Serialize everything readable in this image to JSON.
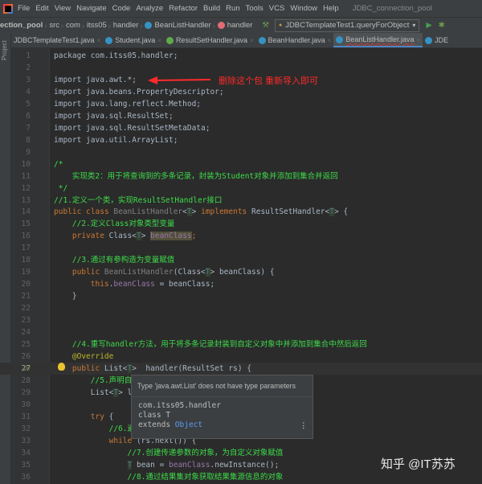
{
  "menubar": {
    "items": [
      "File",
      "Edit",
      "View",
      "Navigate",
      "Code",
      "Analyze",
      "Refactor",
      "Build",
      "Run",
      "Tools",
      "VCS",
      "Window",
      "Help"
    ],
    "window_title": "JDBC_connection_pool"
  },
  "navbar": {
    "project": "ection_pool",
    "crumbs": [
      "src",
      "com",
      "itss05",
      "handler"
    ],
    "class_crumb": "BeanListHandler",
    "method_crumb": "handler",
    "run_config": "JDBCTemplateTest1.queryForObject"
  },
  "side_label": "Project",
  "tabs": [
    {
      "label": "JDBCTemplateTest1.java",
      "icon": "class"
    },
    {
      "label": "Student.java",
      "icon": "class"
    },
    {
      "label": "ResultSetHandler.java",
      "icon": "interface"
    },
    {
      "label": "BeanHandler.java",
      "icon": "class"
    },
    {
      "label": "BeanListHandler.java",
      "icon": "class",
      "active": true
    },
    {
      "label": "JDE",
      "icon": "class"
    }
  ],
  "code_lines": [
    [
      [
        "package com.itss05.handler;",
        "pl"
      ]
    ],
    [],
    [
      [
        "import java.awt.*;",
        "pl"
      ]
    ],
    [
      [
        "import java.beans.PropertyDescriptor;",
        "pl"
      ]
    ],
    [
      [
        "import java.lang.reflect.Method;",
        "pl"
      ]
    ],
    [
      [
        "import java.sql.ResultSet;",
        "pl"
      ]
    ],
    [
      [
        "import java.sql.ResultSetMetaData;",
        "pl"
      ]
    ],
    [
      [
        "import java.util.ArrayList;",
        "pl"
      ]
    ],
    [],
    [
      [
        "/*",
        "gc"
      ]
    ],
    [
      [
        "    实现类2：用于将查询到的多条记录，封装为Student对象并添加到集合并返回",
        "gc"
      ]
    ],
    [
      [
        " */",
        "gc"
      ]
    ],
    [
      [
        "//1.定义一个类，实现ResultSetHandler接口",
        "gc"
      ]
    ],
    [
      [
        "public class ",
        "kw"
      ],
      [
        "BeanListHandler",
        "gr"
      ],
      [
        "<",
        "pl"
      ],
      [
        "T",
        "tp"
      ],
      [
        "> ",
        "pl"
      ],
      [
        "implements ",
        "kw"
      ],
      [
        "ResultSetHandler<",
        "pl"
      ],
      [
        "T",
        "tp"
      ],
      [
        "> {",
        "pl"
      ]
    ],
    [
      [
        "    //2.定义Class对象类型变量",
        "gc"
      ]
    ],
    [
      [
        "    private ",
        "kw"
      ],
      [
        "Class<",
        "pl"
      ],
      [
        "T",
        "tp"
      ],
      [
        "> ",
        "pl"
      ],
      [
        "beanClass",
        "hl"
      ],
      [
        ";",
        "kw"
      ]
    ],
    [],
    [
      [
        "    //3.通过有参构造为变量赋值",
        "gc"
      ]
    ],
    [
      [
        "    public ",
        "kw"
      ],
      [
        "BeanListHandler",
        "gr"
      ],
      [
        "(Class<",
        "pl"
      ],
      [
        "T",
        "tp"
      ],
      [
        "> beanClass) {",
        "pl"
      ]
    ],
    [
      [
        "        this",
        "kw"
      ],
      [
        ".",
        "pl"
      ],
      [
        "beanClass",
        "fd"
      ],
      [
        " = beanClass;",
        "pl"
      ]
    ],
    [
      [
        "    }",
        "pl"
      ]
    ],
    [],
    [],
    [],
    [
      [
        "    //4.重写handler方法，用于将多条记录封装到自定义对象中并添加到集合中然后返回",
        "gc"
      ]
    ],
    [
      [
        "    @Override",
        "an"
      ]
    ],
    [
      [
        "    public ",
        "kw"
      ],
      [
        "List<",
        "pl"
      ],
      [
        "T",
        "tp"
      ],
      [
        ">  handler(ResultSet rs) {",
        "pl"
      ]
    ],
    [
      [
        "        //5.声明自",
        "gc"
      ]
    ],
    [
      [
        "        List<",
        "pl"
      ],
      [
        "T",
        "tp"
      ],
      [
        "> l",
        "pl"
      ]
    ],
    [],
    [
      [
        "        try ",
        "kw"
      ],
      [
        "{",
        "pl"
      ]
    ],
    [
      [
        "            //6.遍",
        "gc"
      ]
    ],
    [
      [
        "            while ",
        "kw"
      ],
      [
        "(rs.next()) {",
        "pl"
      ]
    ],
    [
      [
        "                //7.创建传递参数的对象，为自定义对象赋值",
        "gc"
      ]
    ],
    [
      [
        "                ",
        "pl"
      ],
      [
        "T",
        "tp"
      ],
      [
        " bean = ",
        "pl"
      ],
      [
        "beanClass",
        "fd"
      ],
      [
        ".newInstance();",
        "pl"
      ]
    ],
    [
      [
        "                //8.通过结果集对象获取结果集源信息的对象",
        "gc"
      ]
    ]
  ],
  "annotation": "删除这个包 重新导入即可",
  "tooltip": {
    "title": "Type 'java.awt.List' does not have type parameters",
    "package": "com.itss05.handler",
    "class_line": "class T",
    "extends_kw": "extends",
    "extends_type": "Object"
  },
  "watermark": "知乎 @IT苏苏"
}
